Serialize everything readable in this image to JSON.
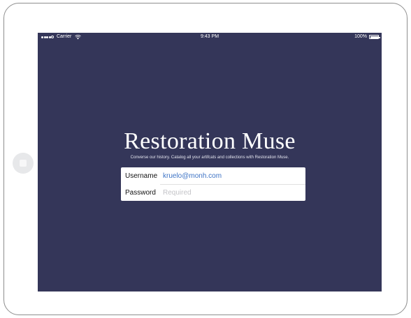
{
  "status_bar": {
    "carrier": "Carrier",
    "time": "9:43 PM",
    "battery": "100%",
    "icons": [
      "signal-dots",
      "wifi-icon",
      "battery-icon"
    ]
  },
  "app": {
    "title": "Restoration Muse",
    "subtitle": "Converse our history. Catalog all your artifcats and collections with Restoration Muse."
  },
  "login": {
    "username_label": "Username",
    "username_value": "kruelo@monh.com",
    "password_label": "Password",
    "password_placeholder": "Required"
  },
  "colors": {
    "screen_background": "#343659",
    "username_value": "#3d73c5",
    "placeholder": "#c3c3c7"
  },
  "device": {
    "home_button_icon": "home-button-icon"
  }
}
